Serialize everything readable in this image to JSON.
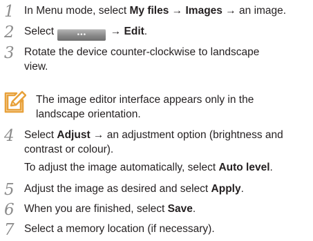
{
  "steps": [
    {
      "num": "1",
      "pre": "In Menu mode, select ",
      "b1": "My files",
      "arrow1": " → ",
      "b2": "Images",
      "post": " → an image."
    },
    {
      "num": "2",
      "pre": "Select ",
      "button_dots": "•••",
      "arrow": " → ",
      "b1": "Edit",
      "post": "."
    },
    {
      "num": "3",
      "line1": "Rotate the device counter-clockwise to landscape",
      "line2": "view."
    },
    {
      "num": "4",
      "pre": "Select ",
      "b1": "Adjust",
      "post1": " → an adjustment option (brightness and",
      "line2": "contrast or colour)."
    },
    {
      "num": "5",
      "pre": "Adjust the image as desired and select ",
      "b1": "Apply",
      "post": "."
    },
    {
      "num": "6",
      "pre": "When you are finished, select ",
      "b1": "Save",
      "post": "."
    },
    {
      "num": "7",
      "text": "Select a memory location (if necessary)."
    }
  ],
  "note": {
    "icon": "note-pencil-icon",
    "line1": "The image editor interface appears only in the",
    "line2": "landscape orientation."
  },
  "step4_sub": {
    "pre": "To adjust the image automatically, select ",
    "b1": "Auto level",
    "post": "."
  },
  "colors": {
    "text": "#231f20",
    "step_number": "#8c8c8c",
    "note_icon": "#e8a13a"
  }
}
